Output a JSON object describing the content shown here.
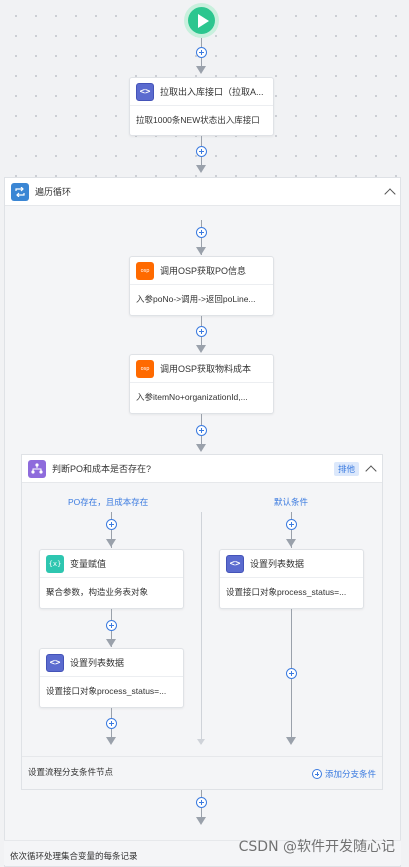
{
  "start": {
    "icon": "play-icon",
    "color": "#2cc68f"
  },
  "nodes": {
    "fetch_outbound": {
      "icon": "code-icon",
      "title": "拉取出入库接口（拉取A...",
      "body": "拉取1000条NEW状态出入库接口"
    },
    "loop": {
      "icon": "loop-icon",
      "title": "遍历循环"
    },
    "osp_po": {
      "icon": "osp-icon",
      "icon_text": "osp",
      "title": "调用OSP获取PO信息",
      "body": "入参poNo->调用->返回poLine..."
    },
    "osp_cost": {
      "icon": "osp-icon",
      "icon_text": "osp",
      "title": "调用OSP获取物料成本",
      "body": "入参itemNo+organizationId,..."
    },
    "branch": {
      "icon": "branch-icon",
      "title": "判断PO和成本是否存在?",
      "sort_label": "排他"
    },
    "var_assign": {
      "icon": "variable-icon",
      "icon_text": "{x}",
      "title": "变量赋值",
      "body": "聚合参数，构造业务表对象"
    },
    "set_list_left": {
      "icon": "code-icon",
      "title": "设置列表数据",
      "body": "设置接口对象process_status=..."
    },
    "set_list_right": {
      "icon": "code-icon",
      "title": "设置列表数据",
      "body": "设置接口对象process_status=..."
    }
  },
  "branches": {
    "left_label": "PO存在，且成本存在",
    "right_label": "默认条件",
    "footer_hint": "设置流程分支条件节点",
    "add_branch": "添加分支条件"
  },
  "bottom_text": "依次循环处理集合变量的每条记录",
  "watermark": "CSDN @软件开发随心记",
  "colors": {
    "accent": "#3b7be0",
    "connector": "#9aa1ab",
    "osp": "#ff6a00",
    "code": "#5b6bcf",
    "branch": "#8e6bdc",
    "variable": "#2ec6b0"
  }
}
